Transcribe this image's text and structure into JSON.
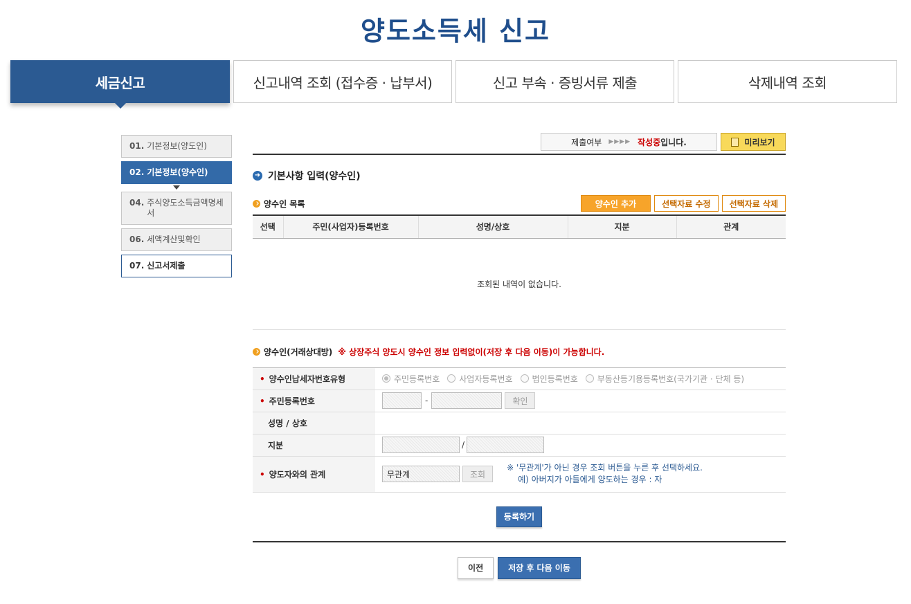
{
  "page_title": "양도소득세 신고",
  "tabs": [
    {
      "label": "세금신고",
      "active": true
    },
    {
      "label": "신고내역 조회 (접수증 · 납부서)",
      "active": false
    },
    {
      "label": "신고 부속 · 증빙서류 제출",
      "active": false
    },
    {
      "label": "삭제내역 조회",
      "active": false
    }
  ],
  "steps": [
    {
      "num": "01.",
      "label": "기본정보(양도인)"
    },
    {
      "num": "02.",
      "label": "기본정보(양수인)"
    },
    {
      "num": "04.",
      "label": "주식양도소득금액명세서"
    },
    {
      "num": "06.",
      "label": "세액계산및확인"
    },
    {
      "num": "07.",
      "label": "신고서제출"
    }
  ],
  "status": {
    "label": "제출여부",
    "arrows": "▶▶▶▶",
    "state": "작성중",
    "suffix": "입니다.",
    "preview_label": "미리보기"
  },
  "section_title": "기본사항 입력(양수인)",
  "list": {
    "title": "양수인 목록",
    "add_label": "양수인 추가",
    "edit_label": "선택자료 수정",
    "delete_label": "선택자료 삭제",
    "columns": [
      "선택",
      "주민(사업자)등록번호",
      "성명/상호",
      "지분",
      "관계"
    ],
    "empty_text": "조회된 내역이 없습니다."
  },
  "form": {
    "title": "양수인(거래상대방)",
    "warning": "※ 상장주식 양도시 양수인 정보 입력없이(저장 후 다음 이동)이 가능합니다.",
    "required_mark": "•",
    "rows": {
      "type_label": "양수인납세자번호유형",
      "type_options": [
        "주민등록번호",
        "사업자등록번호",
        "법인등록번호",
        "부동산등기용등록번호(국가기관 · 단체 등)"
      ],
      "id_label": "주민등록번호",
      "id_sep": "-",
      "confirm_label": "확인",
      "name_label": "성명 / 상호",
      "share_label": "지분",
      "share_sep": "/",
      "relation_label": "양도자와의 관계",
      "relation_value": "무관계",
      "lookup_label": "조회",
      "note_line1": "※ '무관계'가 아닌 경우 조회 버튼을 누른 후 선택하세요.",
      "note_line2": "예) 아버지가 아들에게 양도하는 경우 : 자"
    },
    "register_label": "등록하기"
  },
  "footer": {
    "prev_label": "이전",
    "next_label": "저장 후 다음 이동"
  },
  "colors": {
    "brand_blue": "#2b5a92",
    "accent_orange": "#f7a42a",
    "warning_red": "#cc0000"
  }
}
